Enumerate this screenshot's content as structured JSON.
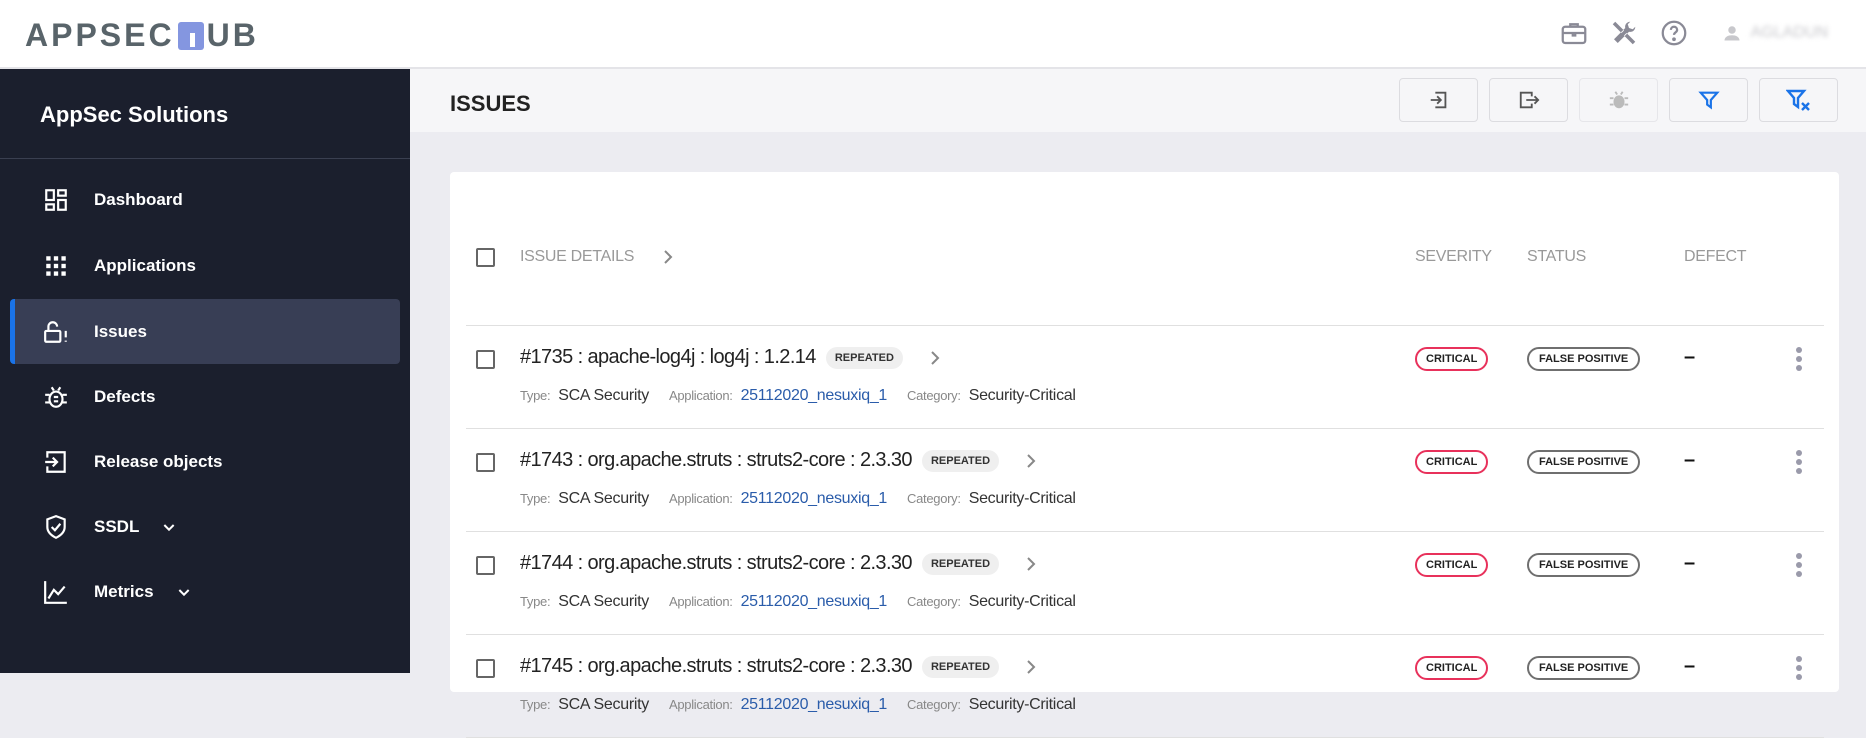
{
  "app": {
    "logo": "APPSECHUB",
    "user": "AGLADUN"
  },
  "sidebar": {
    "org": "AppSec Solutions",
    "items": [
      {
        "label": "Dashboard",
        "icon": "dashboard-icon"
      },
      {
        "label": "Applications",
        "icon": "apps-grid-icon"
      },
      {
        "label": "Issues",
        "icon": "lock-alert-icon",
        "active": true
      },
      {
        "label": "Defects",
        "icon": "bug-icon"
      },
      {
        "label": "Release objects",
        "icon": "import-icon"
      },
      {
        "label": "SSDL",
        "icon": "shield-check-icon",
        "expandable": true
      },
      {
        "label": "Metrics",
        "icon": "chart-line-icon",
        "expandable": true
      }
    ]
  },
  "page": {
    "title": "ISSUES"
  },
  "table": {
    "headers": {
      "details": "ISSUE DETAILS",
      "severity": "SEVERITY",
      "status": "STATUS",
      "defect": "DEFECT"
    },
    "meta_labels": {
      "type": "Type:",
      "application": "Application:",
      "category": "Category:"
    },
    "rows": [
      {
        "title": "#1735 : apache-log4j : log4j : 1.2.14",
        "badge": "REPEATED",
        "type": "SCA Security",
        "application": "25112020_nesuxiq_1",
        "category": "Security-Critical",
        "severity": "CRITICAL",
        "status": "FALSE POSITIVE",
        "defect": "–"
      },
      {
        "title": "#1743 : org.apache.struts : struts2-core : 2.3.30",
        "badge": "REPEATED",
        "type": "SCA Security",
        "application": "25112020_nesuxiq_1",
        "category": "Security-Critical",
        "severity": "CRITICAL",
        "status": "FALSE POSITIVE",
        "defect": "–"
      },
      {
        "title": "#1744 : org.apache.struts : struts2-core : 2.3.30",
        "badge": "REPEATED",
        "type": "SCA Security",
        "application": "25112020_nesuxiq_1",
        "category": "Security-Critical",
        "severity": "CRITICAL",
        "status": "FALSE POSITIVE",
        "defect": "–"
      },
      {
        "title": "#1745 : org.apache.struts : struts2-core : 2.3.30",
        "badge": "REPEATED",
        "type": "SCA Security",
        "application": "25112020_nesuxiq_1",
        "category": "Security-Critical",
        "severity": "CRITICAL",
        "status": "FALSE POSITIVE",
        "defect": "–"
      }
    ]
  },
  "colors": {
    "sidebar": "#1b1f2d",
    "active": "#383e55",
    "accent": "#1a73e8",
    "critical": "#e8315b",
    "link": "#2a5caa",
    "logo_h": "#8496e0"
  }
}
